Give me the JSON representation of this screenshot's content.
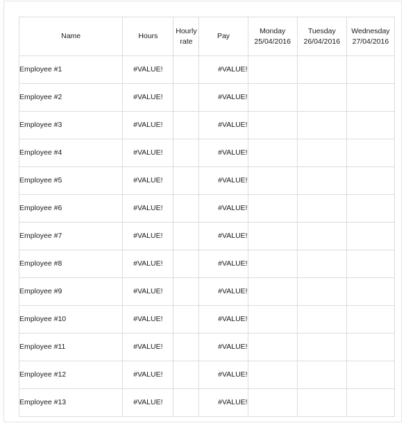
{
  "document": {
    "type": "timesheet-table",
    "background_color": "#ffffff",
    "border_color": "#dcdcdc",
    "text_color": "#1a1a1a"
  },
  "table": {
    "columns": [
      {
        "key": "name",
        "label_line1": "Name",
        "label_line2": "",
        "align": "left"
      },
      {
        "key": "hours",
        "label_line1": "Hours",
        "label_line2": "",
        "align": "center"
      },
      {
        "key": "rate",
        "label_line1": "Hourly",
        "label_line2": "rate",
        "align": "center"
      },
      {
        "key": "pay",
        "label_line1": "Pay",
        "label_line2": "",
        "align": "right"
      },
      {
        "key": "monday",
        "label_line1": "Monday",
        "label_line2": "25/04/2016",
        "align": "center"
      },
      {
        "key": "tuesday",
        "label_line1": "Tuesday",
        "label_line2": "26/04/2016",
        "align": "center"
      },
      {
        "key": "wednesday",
        "label_line1": "Wednesday",
        "label_line2": "27/04/2016",
        "align": "center"
      }
    ],
    "rows": [
      {
        "name": "Employee #1",
        "hours": "#VALUE!",
        "rate": "",
        "pay": "#VALUE!",
        "monday": "",
        "tuesday": "",
        "wednesday": ""
      },
      {
        "name": "Employee #2",
        "hours": "#VALUE!",
        "rate": "",
        "pay": "#VALUE!",
        "monday": "",
        "tuesday": "",
        "wednesday": ""
      },
      {
        "name": "Employee #3",
        "hours": "#VALUE!",
        "rate": "",
        "pay": "#VALUE!",
        "monday": "",
        "tuesday": "",
        "wednesday": ""
      },
      {
        "name": "Employee #4",
        "hours": "#VALUE!",
        "rate": "",
        "pay": "#VALUE!",
        "monday": "",
        "tuesday": "",
        "wednesday": ""
      },
      {
        "name": "Employee #5",
        "hours": "#VALUE!",
        "rate": "",
        "pay": "#VALUE!",
        "monday": "",
        "tuesday": "",
        "wednesday": ""
      },
      {
        "name": "Employee #6",
        "hours": "#VALUE!",
        "rate": "",
        "pay": "#VALUE!",
        "monday": "",
        "tuesday": "",
        "wednesday": ""
      },
      {
        "name": "Employee #7",
        "hours": "#VALUE!",
        "rate": "",
        "pay": "#VALUE!",
        "monday": "",
        "tuesday": "",
        "wednesday": ""
      },
      {
        "name": "Employee #8",
        "hours": "#VALUE!",
        "rate": "",
        "pay": "#VALUE!",
        "monday": "",
        "tuesday": "",
        "wednesday": ""
      },
      {
        "name": "Employee #9",
        "hours": "#VALUE!",
        "rate": "",
        "pay": "#VALUE!",
        "monday": "",
        "tuesday": "",
        "wednesday": ""
      },
      {
        "name": "Employee #10",
        "hours": "#VALUE!",
        "rate": "",
        "pay": "#VALUE!",
        "monday": "",
        "tuesday": "",
        "wednesday": ""
      },
      {
        "name": "Employee #11",
        "hours": "#VALUE!",
        "rate": "",
        "pay": "#VALUE!",
        "monday": "",
        "tuesday": "",
        "wednesday": ""
      },
      {
        "name": "Employee #12",
        "hours": "#VALUE!",
        "rate": "",
        "pay": "#VALUE!",
        "monday": "",
        "tuesday": "",
        "wednesday": ""
      },
      {
        "name": "Employee #13",
        "hours": "#VALUE!",
        "rate": "",
        "pay": "#VALUE!",
        "monday": "",
        "tuesday": "",
        "wednesday": ""
      }
    ]
  }
}
